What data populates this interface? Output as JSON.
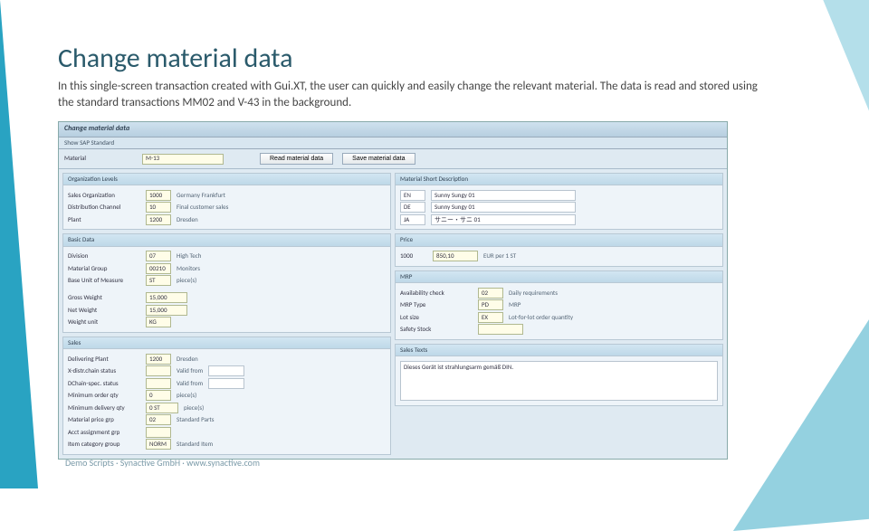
{
  "slide": {
    "title": "Change material data",
    "intro": "In this single-screen transaction created with Gui.XT, the user can quickly and easily change the relevant material. The data is read and stored using the standard transactions MM02 and V-43 in the background.",
    "footer": "Demo Scripts · Synactive GmbH · www.synactive.com"
  },
  "sap": {
    "header": "Change material data",
    "subheader": "Show SAP Standard",
    "toolbar": {
      "material_label": "Material",
      "material_value": "M-13",
      "btn_read": "Read material data",
      "btn_save": "Save material data"
    },
    "org": {
      "title": "Organization Levels",
      "rows": [
        {
          "label": "Sales Organization",
          "value": "1000",
          "desc": "Germany Frankfurt"
        },
        {
          "label": "Distribution Channel",
          "value": "10",
          "desc": "Final customer sales"
        },
        {
          "label": "Plant",
          "value": "1200",
          "desc": "Dresden"
        }
      ]
    },
    "basic": {
      "title": "Basic Data",
      "rows1": [
        {
          "label": "Division",
          "value": "07",
          "desc": "High Tech"
        },
        {
          "label": "Material Group",
          "value": "00210",
          "desc": "Monitors"
        },
        {
          "label": "Base Unit of Measure",
          "value": "ST",
          "desc": "piece(s)"
        }
      ],
      "rows2": [
        {
          "label": "Gross Weight",
          "value": "15,000"
        },
        {
          "label": "Net Weight",
          "value": "15,000"
        },
        {
          "label": "Weight unit",
          "value": "KG"
        }
      ]
    },
    "sales": {
      "title": "Sales",
      "rows": [
        {
          "label": "Delivering Plant",
          "value": "1200",
          "desc": "Dresden"
        },
        {
          "label": "X-distr.chain status",
          "value": "",
          "desc": "Valid from"
        },
        {
          "label": "DChain-spec. status",
          "value": "",
          "desc": "Valid from"
        },
        {
          "label": "Minimum order qty",
          "value": "0",
          "desc": "piece(s)"
        },
        {
          "label": "Minimum delivery qty",
          "value": "0 ST",
          "desc": "piece(s)"
        },
        {
          "label": "Material price grp",
          "value": "02",
          "desc": "Standard Parts"
        },
        {
          "label": "Acct assignment grp",
          "value": "",
          "desc": ""
        },
        {
          "label": "Item category group",
          "value": "NORM",
          "desc": "Standard Item"
        }
      ]
    },
    "shortdesc": {
      "title": "Material Short Description",
      "rows": [
        {
          "lang": "EN",
          "text": "Sunny Sungy 01"
        },
        {
          "lang": "DE",
          "text": "Sunny Sungy 01"
        },
        {
          "lang": "JA",
          "text": "サニー・サニ 01"
        }
      ]
    },
    "price": {
      "title": "Price",
      "rows": [
        {
          "label": "1000",
          "value": "850,10",
          "desc": "EUR per 1 ST"
        }
      ]
    },
    "mrp": {
      "title": "MRP",
      "rows": [
        {
          "label": "Availability check",
          "value": "02",
          "desc": "Daily requirements"
        },
        {
          "label": "MRP Type",
          "value": "PD",
          "desc": "MRP"
        },
        {
          "label": "Lot size",
          "value": "EX",
          "desc": "Lot-for-lot order quantity"
        },
        {
          "label": "Safety Stock",
          "value": "",
          "desc": ""
        }
      ]
    },
    "salestexts": {
      "title": "Sales Texts",
      "text": "Dieses Gerät ist strahlungsarm gemäß DIN."
    }
  }
}
